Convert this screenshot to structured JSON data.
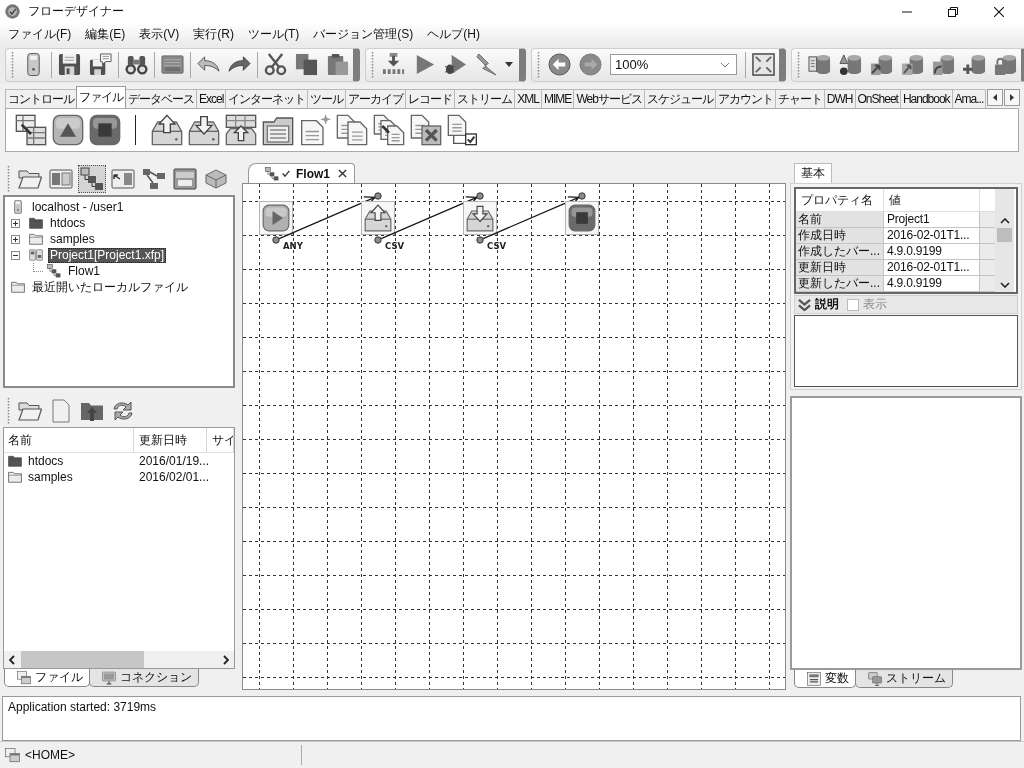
{
  "window": {
    "title": "フローデザイナー"
  },
  "menu": [
    "ファイル(F)",
    "編集(E)",
    "表示(V)",
    "実行(R)",
    "ツール(T)",
    "バージョン管理(S)",
    "ヘルプ(H)"
  ],
  "toolbar": {
    "zoom": {
      "value": "100%"
    }
  },
  "palette": {
    "tabs": [
      {
        "label": "コントロール",
        "selected": false
      },
      {
        "label": "ファイル",
        "selected": true
      },
      {
        "label": "データベース",
        "selected": false
      },
      {
        "label": "Excel",
        "selected": false
      },
      {
        "label": "インターネット",
        "selected": false
      },
      {
        "label": "ツール",
        "selected": false
      },
      {
        "label": "アーカイブ",
        "selected": false
      },
      {
        "label": "レコード",
        "selected": false
      },
      {
        "label": "ストリーム",
        "selected": false
      },
      {
        "label": "XML",
        "selected": false
      },
      {
        "label": "MIME",
        "selected": false
      },
      {
        "label": "Webサービス",
        "selected": false
      },
      {
        "label": "スケジュール",
        "selected": false
      },
      {
        "label": "アカウント",
        "selected": false
      },
      {
        "label": "チャート",
        "selected": false
      },
      {
        "label": "DWH",
        "selected": false
      },
      {
        "label": "OnSheet",
        "selected": false
      },
      {
        "label": "Handbook",
        "selected": false
      },
      {
        "label": "Ama...",
        "selected": false
      }
    ]
  },
  "explorer": {
    "view_buttons": [
      {
        "selected": false
      },
      {
        "selected": false
      },
      {
        "selected": true
      },
      {
        "selected": false
      },
      {
        "selected": false
      },
      {
        "selected": false
      },
      {
        "selected": false
      }
    ],
    "tree": [
      {
        "label": "localhost - /user1",
        "kind": "host",
        "selected": false,
        "children": [
          {
            "label": "htdocs",
            "kind": "webfolder",
            "expanded": false,
            "selected": false
          },
          {
            "label": "samples",
            "kind": "folder",
            "expanded": false,
            "selected": false
          },
          {
            "label": "Project1[Project1.xfp]",
            "kind": "project",
            "expanded": true,
            "selected": true,
            "children": [
              {
                "label": "Flow1",
                "kind": "flow",
                "selected": false
              }
            ]
          }
        ]
      },
      {
        "label": "最近開いたローカルファイル",
        "kind": "folder",
        "selected": false
      }
    ]
  },
  "files": {
    "columns": [
      "名前",
      "更新日時",
      "サイ"
    ],
    "rows": [
      {
        "kind": "webfolder",
        "cells": [
          "htdocs",
          "2016/01/19..."
        ]
      },
      {
        "kind": "folder",
        "cells": [
          "samples",
          "2016/02/01..."
        ]
      }
    ]
  },
  "left_tabs": [
    {
      "label": "ファイル",
      "selected": true
    },
    {
      "label": "コネクション",
      "selected": false
    }
  ],
  "editor": {
    "tabs": [
      {
        "label": "Flow1",
        "selected": true
      }
    ],
    "nodes": [
      {
        "kind": "start",
        "output": "ANY",
        "linked": true
      },
      {
        "kind": "upload",
        "output": "CSV",
        "linked": true
      },
      {
        "kind": "download",
        "output": "CSV",
        "linked": true
      },
      {
        "kind": "stop",
        "linked": false
      }
    ]
  },
  "properties": {
    "tabs": [
      {
        "label": "基本",
        "selected": true
      }
    ],
    "columns": [
      "プロパティ名",
      "値"
    ],
    "rows": [
      [
        "名前",
        "Project1"
      ],
      [
        "作成日時",
        "2016-02-01T1..."
      ],
      [
        "作成したバー...",
        "4.9.0.9199"
      ],
      [
        "更新日時",
        "2016-02-01T1..."
      ],
      [
        "更新したバー...",
        "4.9.0.9199"
      ]
    ],
    "description": {
      "label": "説明",
      "checkbox": {
        "label": "表示",
        "checked": false,
        "disabled": true
      }
    }
  },
  "right_tabs": [
    {
      "label": "変数",
      "selected": true
    },
    {
      "label": "ストリーム",
      "selected": false
    }
  ],
  "log": [
    "Application started: 3719ms"
  ],
  "status_bar": {
    "path": "<HOME>"
  }
}
